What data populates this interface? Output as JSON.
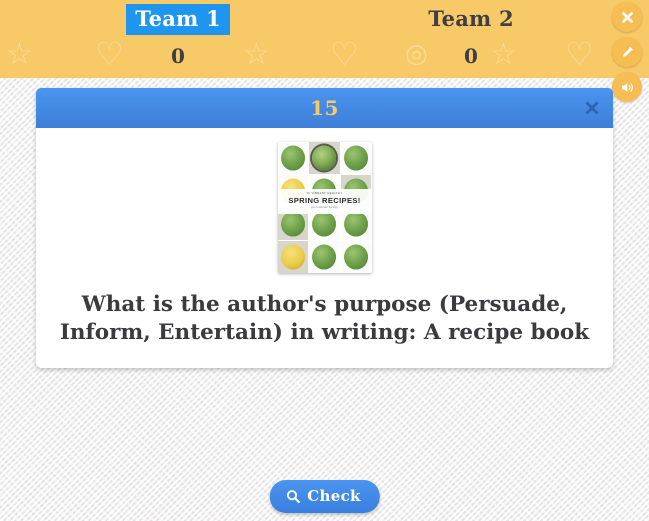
{
  "scoreboard": {
    "teams": [
      {
        "name": "Team 1",
        "score": "0",
        "active": true
      },
      {
        "name": "Team 2",
        "score": "0",
        "active": false
      }
    ],
    "decorations": [
      "star-icon",
      "heart-icon",
      "star-icon",
      "heart-icon",
      "question-circle-icon",
      "star-icon",
      "heart-icon"
    ]
  },
  "tools": [
    {
      "name": "close-button",
      "icon": "close-icon"
    },
    {
      "name": "edit-button",
      "icon": "pencil-icon"
    },
    {
      "name": "sound-button",
      "icon": "speaker-icon"
    }
  ],
  "modal": {
    "index": "15",
    "close_icon": "close-icon",
    "image": {
      "alt": "recipe-book-cover",
      "kicker": "30 VIBRANT HEALTHY",
      "title": "SPRING RECIPES!",
      "subtitle": "(to Celebrate Spring)"
    },
    "question": "What is the author's purpose (Persuade, Inform, Entertain) in writing: A recipe book"
  },
  "check_button": {
    "label": "Check",
    "icon": "search-icon"
  },
  "colors": {
    "scorebar": "#f8c967",
    "accent_blue": "#1e96f0",
    "modal_header_blue": "#4a95ef",
    "modal_index_gold": "#f8c967",
    "text_dark": "#3a3a3f"
  }
}
